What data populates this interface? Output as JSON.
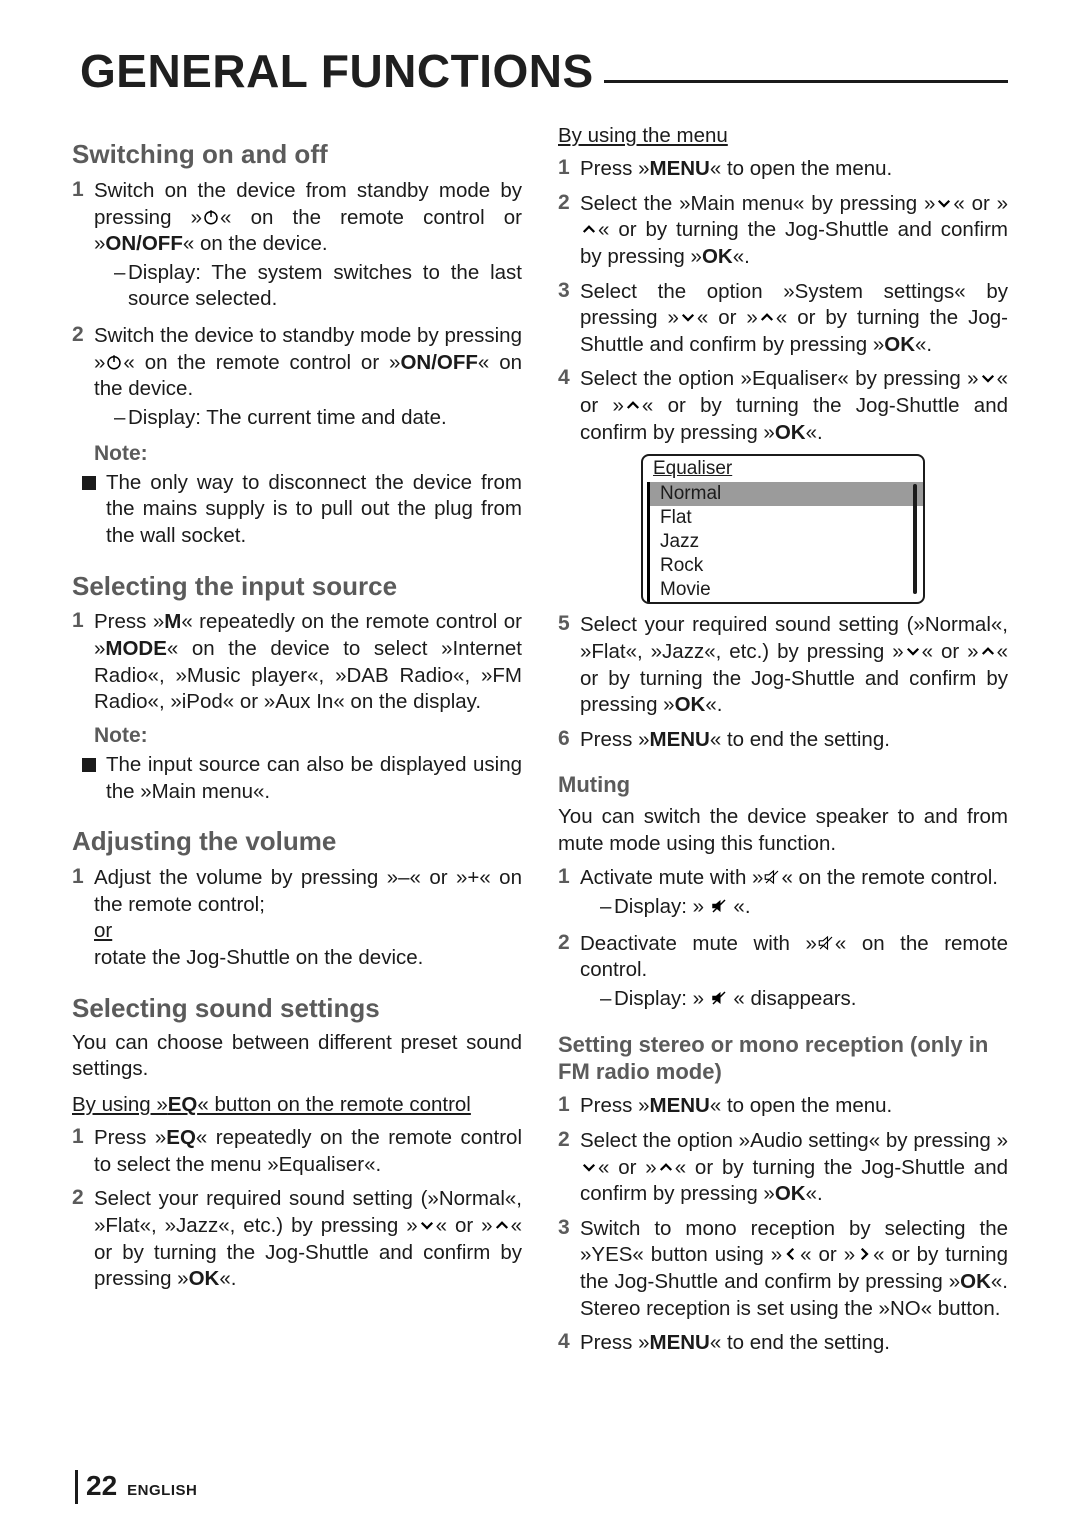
{
  "title": "GENERAL FUNCTIONS",
  "footer": {
    "page": "22",
    "lang": "ENGLISH"
  },
  "left": {
    "h_switch": "Switching on and off",
    "sw1_a": "Switch on the device from standby mode by pressing »",
    "sw1_b": "« on the remote control or »",
    "sw1_c": "ON/OFF",
    "sw1_d": "« on the device.",
    "sw1_dash": "Display: The system switches to the last source selected.",
    "sw2_a": "Switch the device to standby mode by pressing »",
    "sw2_b": "« on the remote control or »",
    "sw2_c": "ON/OFF",
    "sw2_d": "« on the device.",
    "sw2_dash": "Display: The current time and date.",
    "note": "Note:",
    "sw_note": "The only way to disconnect the device from the mains supply is to pull out the plug from the wall socket.",
    "h_src": "Selecting the input source",
    "src1_a": "Press »",
    "src1_b": "M",
    "src1_c": "« repeatedly on the remote control or »",
    "src1_d": "MODE",
    "src1_e": "« on the device to select »Internet Radio«, »Music player«, »DAB Radio«, »FM Radio«, »iPod« or »Aux In« on the display.",
    "src_note": "The input source can also be displayed using the »Main menu«.",
    "h_vol": "Adjusting the volume",
    "vol_a": "Adjust the volume by pressing »–« or »+« on the remote control;",
    "vol_or": "or",
    "vol_b": "rotate the Jog-Shuttle on the device.",
    "h_snd": "Selecting sound settings",
    "snd_intro": "You can choose between different preset sound settings.",
    "snd_sub_a": "By using »",
    "snd_sub_b": "EQ",
    "snd_sub_c": "« button on the remote control",
    "snd1_a": "Press »",
    "snd1_b": "EQ",
    "snd1_c": "« repeatedly on the remote control to select the menu »Equaliser«.",
    "snd2_a": "Select your required sound setting (»Normal«, »Flat«, »Jazz«, etc.) by pressing »",
    "snd2_b": "« or »",
    "snd2_c": "« or by turning the Jog-Shuttle and confirm by pressing »",
    "snd2_d": "OK",
    "snd2_e": "«."
  },
  "right": {
    "menu_sub": "By using the menu",
    "m1_a": "Press »",
    "m1_b": "MENU",
    "m1_c": "« to open the menu.",
    "m2_a": "Select the »Main menu« by pressing »",
    "m2_b": "« or »",
    "m2_c": "« or by turning the Jog-Shuttle and confirm by pressing »",
    "m2_d": "OK",
    "m2_e": "«.",
    "m3_a": "Select the option »System settings« by pressing »",
    "m3_b": "« or »",
    "m3_c": "« or by turning the Jog-Shuttle and confirm by pressing »",
    "m3_d": "OK",
    "m3_e": "«.",
    "m4_a": "Select the option »Equaliser« by pressing »",
    "m4_b": "« or »",
    "m4_c": "« or by turning the Jog-Shuttle and confirm by pressing »",
    "m4_d": "OK",
    "m4_e": "«.",
    "eq_title": "Equaliser",
    "eq_items": [
      "Normal",
      "Flat",
      "Jazz",
      "Rock",
      "Movie"
    ],
    "m5_a": "Select your required sound setting (»Normal«, »Flat«, »Jazz«, etc.) by pressing »",
    "m5_b": "« or »",
    "m5_c": "« or by turning the Jog-Shuttle and confirm by pressing »",
    "m5_d": "OK",
    "m5_e": "«.",
    "m6_a": "Press »",
    "m6_b": "MENU",
    "m6_c": "« to end the setting.",
    "h_mute": "Muting",
    "mute_intro": "You can switch the device speaker to and from mute mode using this function.",
    "mu1_a": "Activate mute with »",
    "mu1_b": "« on the remote control.",
    "mu1_dash_a": "Display: » ",
    "mu1_dash_b": " «.",
    "mu2_a": "Deactivate mute with »",
    "mu2_b": "« on the remote control.",
    "mu2_dash_a": "Display: » ",
    "mu2_dash_b": " « disappears.",
    "h_sm": "Setting stereo or mono reception (only in FM radio mode)",
    "sm1_a": "Press »",
    "sm1_b": "MENU",
    "sm1_c": "« to open the menu.",
    "sm2_a": "Select the option »Audio setting« by pressing »",
    "sm2_b": "« or »",
    "sm2_c": "« or by turning the Jog-Shuttle and confirm by pressing »",
    "sm2_d": "OK",
    "sm2_e": "«.",
    "sm3_a": "Switch to mono reception by selecting the »YES« button using »",
    "sm3_b": "« or »",
    "sm3_c": "« or by turning the Jog-Shuttle and confirm by pressing »",
    "sm3_d": "OK",
    "sm3_e": "«. Stereo reception is set using the »NO« button.",
    "sm4_a": "Press »",
    "sm4_b": "MENU",
    "sm4_c": "« to end the setting."
  }
}
